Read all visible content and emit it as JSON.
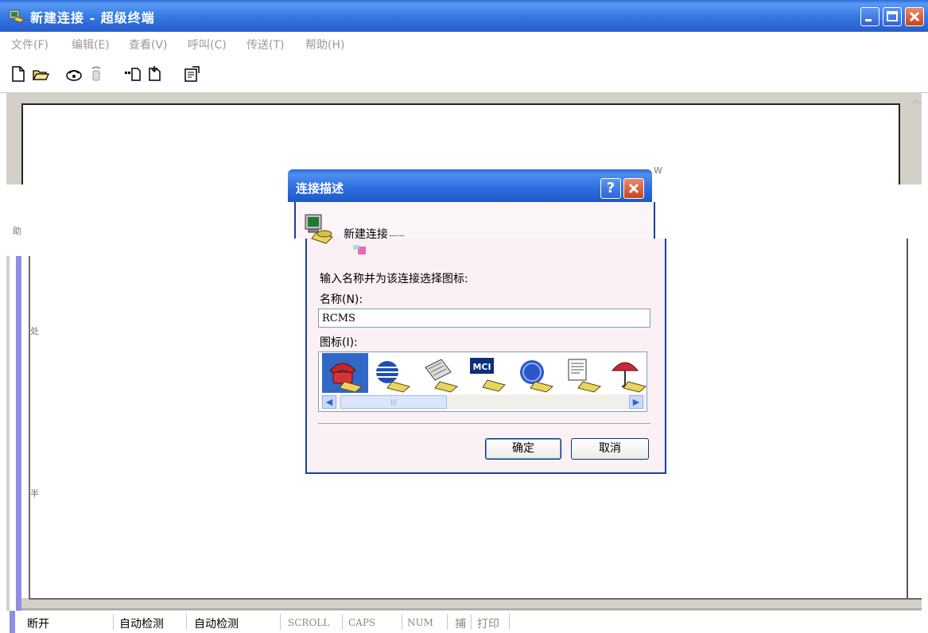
{
  "window": {
    "title": "新建连接 - 超级终端",
    "icon": "hyperterminal-icon"
  },
  "menu": [
    "文件(F)",
    "编辑(E)",
    "查看(V)",
    "呼叫(C)",
    "传送(T)",
    "帮助(H)"
  ],
  "toolbar": [
    "new-icon",
    "open-icon",
    "call-icon",
    "hangup-icon",
    "send-icon",
    "receive-icon",
    "properties-icon"
  ],
  "terminal": {
    "garbled_text": [
      "W",
      "助",
      "处",
      "半"
    ]
  },
  "dialog": {
    "title": "连接描述",
    "connection_name_display": "新建连接",
    "prompt": "输入名称并为该连接选择图标:",
    "name_label": "名称(N):",
    "name_value": "RCMS",
    "icon_label": "图标(I):",
    "icons": [
      "phone-icon",
      "globe-icon",
      "fax-icon",
      "mci-icon",
      "ge-icon",
      "document-phone-icon",
      "umbrella-icon"
    ],
    "selected_icon_index": 0,
    "ok": "确定",
    "cancel": "取消"
  },
  "statusbar": {
    "connection": "断开",
    "detect1": "自动检测",
    "detect2": "自动检测",
    "scroll": "SCROLL",
    "caps": "CAPS",
    "num": "NUM",
    "capture": "捕",
    "print": "打印"
  },
  "colors": {
    "titlebar": "#2f6dd8",
    "dialog_bg": "#fbf0f4",
    "selected_icon_bg": "#3168c6",
    "close_button": "#c9421c"
  }
}
